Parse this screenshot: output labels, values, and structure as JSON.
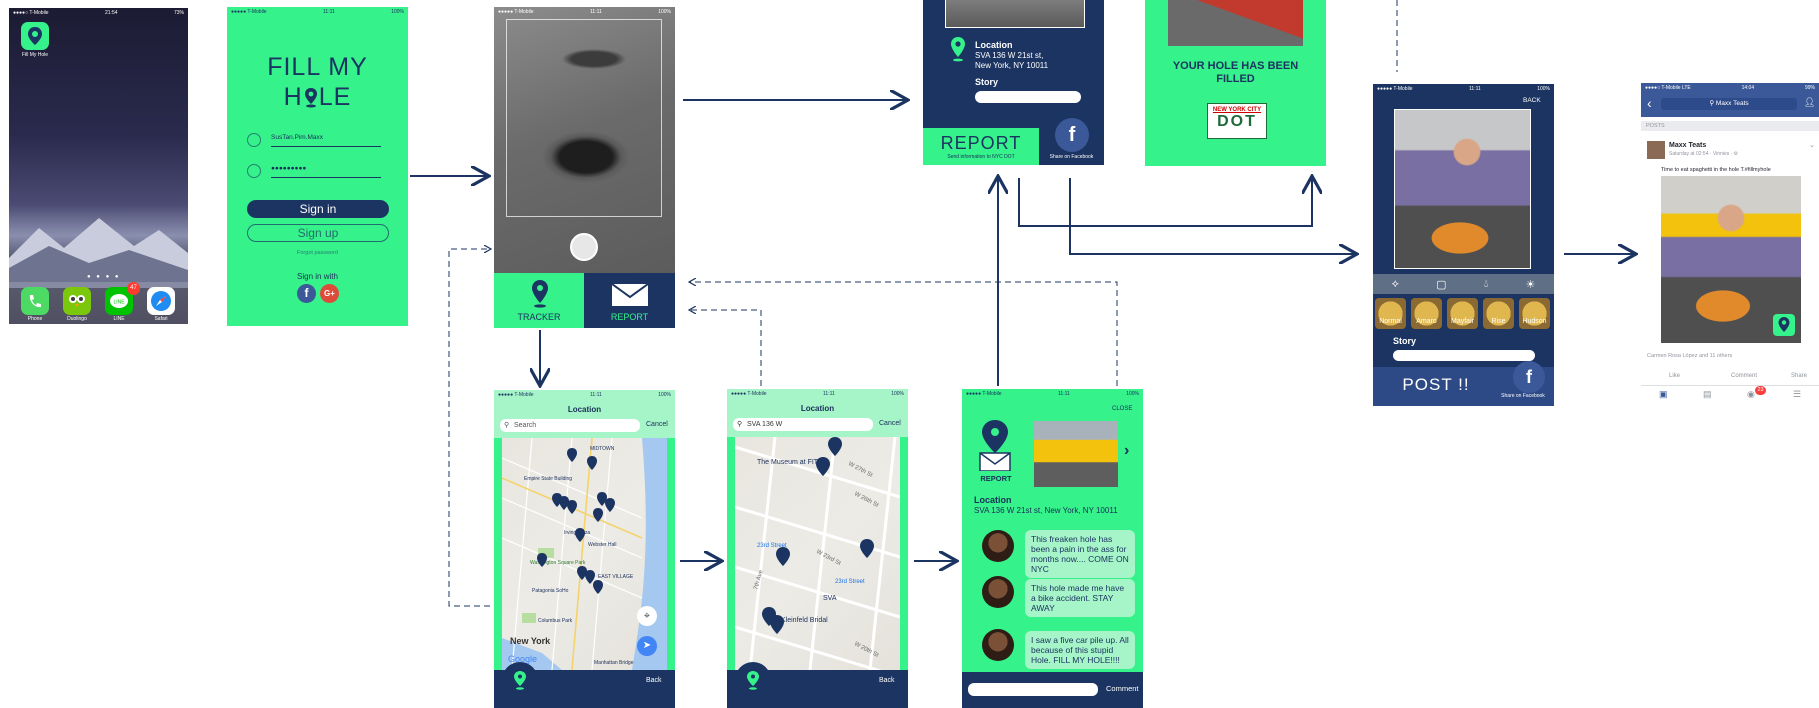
{
  "colors": {
    "navy": "#1b3461",
    "green": "#35f28b",
    "light_green": "#a6f5c8"
  },
  "home": {
    "carrier": "●●●●○ T-Mobile",
    "time": "21:54",
    "battery": "73%",
    "app_label": "Fill My Hole",
    "dock": [
      {
        "label": "Phone",
        "icon": "phone-icon",
        "badge": ""
      },
      {
        "label": "Duolingo",
        "icon": "duolingo-icon",
        "badge": ""
      },
      {
        "label": "LINE",
        "icon": "line-icon",
        "badge": "47"
      },
      {
        "label": "Safari",
        "icon": "safari-icon",
        "badge": ""
      }
    ]
  },
  "login": {
    "carrier": "●●●●● T-Mobile",
    "time": "11:11",
    "battery": "100%",
    "title_line1": "FILL MY",
    "title_line2_a": "H",
    "title_line2_b": "LE",
    "username": "SusTan.Pim.Maxx",
    "password": "●●●●●●●●●",
    "sign_in": "Sign in",
    "sign_up": "Sign up",
    "forgot": "Forgot password",
    "sign_in_with": "Sign in with"
  },
  "camera": {
    "carrier": "●●●●● T-Mobile",
    "time": "11:11",
    "battery": "100%",
    "tracker": "TRACKER",
    "report": "REPORT"
  },
  "report_form": {
    "location_label": "Location",
    "address_line1": "SVA 136 W 21st st,",
    "address_line2": "New York, NY 10011",
    "story_label": "Story",
    "report_button": "REPORT",
    "report_sub": "Send information to NYC DOT",
    "share_label": "Share on Facebook"
  },
  "filled": {
    "message_line1": "YOUR HOLE HAS BEEN",
    "message_line2": "FILLED",
    "dot_line1": "NEW YORK CITY",
    "dot_line2": "DOT"
  },
  "map1": {
    "carrier": "●●●●● T-Mobile",
    "time": "11:11",
    "battery": "100%",
    "title": "Location",
    "search_placeholder": "Search",
    "cancel": "Cancel",
    "labels": [
      "MIDTOWN",
      "Empire State Building",
      "Irving Plaza",
      "Webster Hall",
      "Washington Square Park",
      "EAST VILLAGE",
      "Patagonia SoHo",
      "Columbus Park",
      "New York",
      "Manhattan Bridge",
      "Google"
    ],
    "back": "Back"
  },
  "map2": {
    "carrier": "●●●●● T-Mobile",
    "time": "11:11",
    "battery": "100%",
    "title": "Location",
    "search_value": "SVA 136 W",
    "cancel": "Cancel",
    "labels": [
      "The Museum at FIT",
      "W 27th St",
      "W 26th St",
      "23rd Street",
      "W 23rd St",
      "23rd Street",
      "SVA",
      "Kleinfeld Bridal",
      "7th Ave",
      "W 20th St"
    ],
    "back": "Back"
  },
  "detail": {
    "carrier": "●●●●● T-Mobile",
    "time": "11:11",
    "battery": "100%",
    "close": "CLOSE",
    "report_label": "REPORT",
    "location_label": "Location",
    "address": "SVA 136 W 21st st, New York, NY 10011",
    "comments": [
      "This freaken hole has been a pain in the ass for months now.... COME ON NYC",
      "This hole made me have a bike accident. STAY AWAY",
      "I saw a five car pile up. All because of this stupid Hole. FILL MY HOLE!!!!"
    ],
    "comment_button": "Comment"
  },
  "post": {
    "carrier": "●●●●● T-Mobile",
    "time": "11:11",
    "battery": "100%",
    "back": "BACK",
    "filters": [
      "Normal",
      "Amaro",
      "Mayfair",
      "Rise",
      "Hudson"
    ],
    "story_label": "Story",
    "post_button": "POST !!",
    "share_label": "Share on Facebook"
  },
  "facebook": {
    "carrier": "●●●●○ T-Mobile  LTE",
    "time": "14:04",
    "battery": "99%",
    "search": "Maxx Teats",
    "section": "POSTS",
    "author": "Maxx Teats",
    "meta": "Saturday at 02:54 · Vinnies · ⚙",
    "caption": "Time to eat spaghetti in the hole T.#fillmyhole",
    "reactions": "Carmen Rosa López and 11 others",
    "like": "Like",
    "comment": "Comment",
    "share": "Share",
    "notif_count": "23"
  }
}
